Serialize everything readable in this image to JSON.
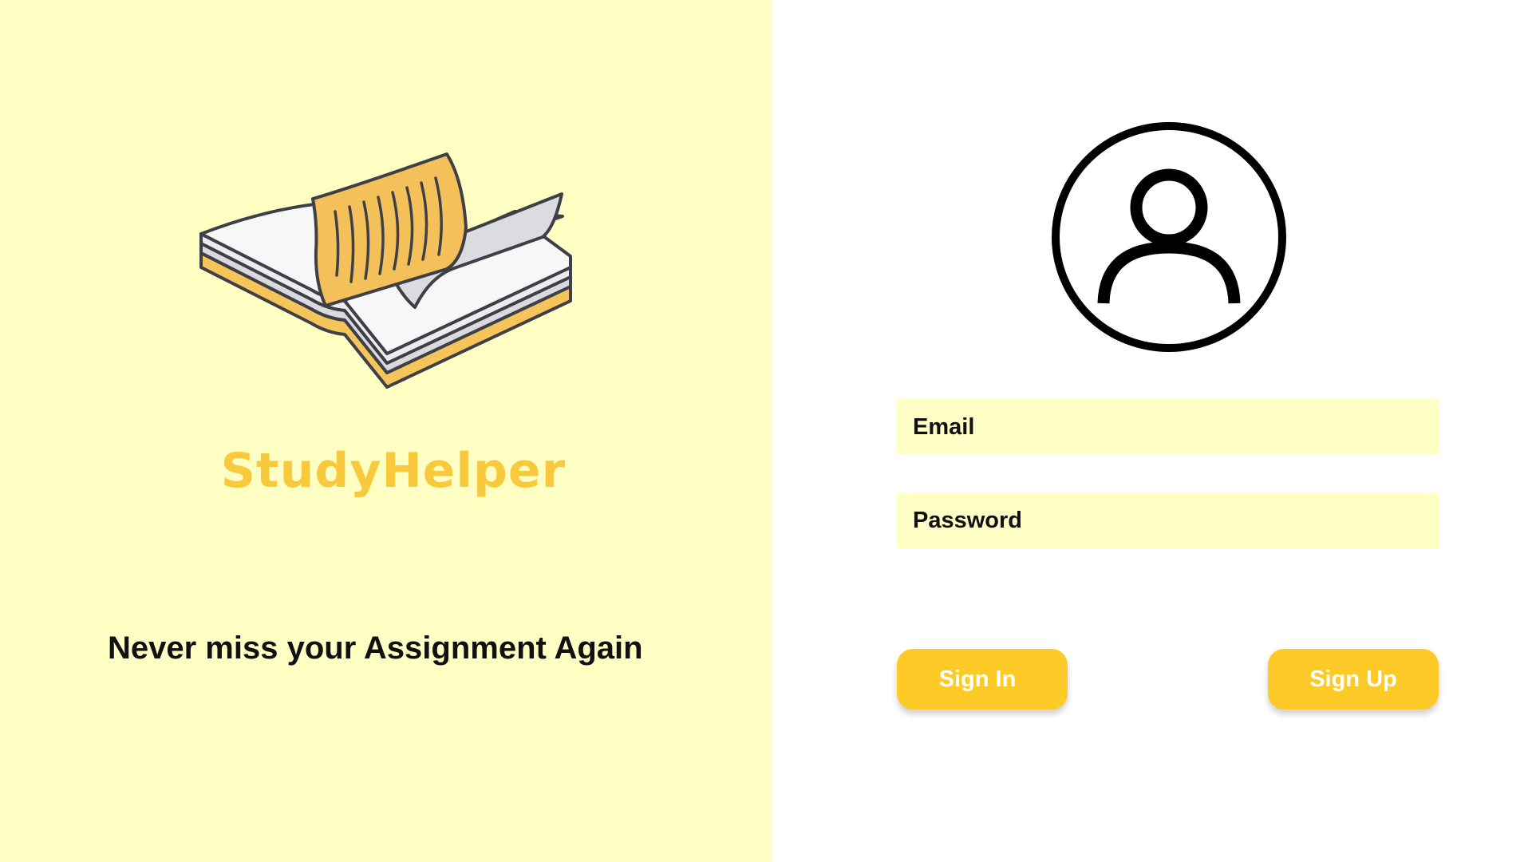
{
  "brand": {
    "name": "StudyHelper",
    "logo_icon": "open-book-icon",
    "tagline": "Never miss your Assignment Again"
  },
  "colors": {
    "left_panel_bg": "#ffffc4",
    "brand_yellow": "#f8c93c",
    "button_yellow": "#fdca28",
    "field_bg": "#ffffc6"
  },
  "login": {
    "avatar_icon": "user-circle-icon",
    "email_label": "Email",
    "password_label": "Password",
    "sign_in_label": "Sign In",
    "sign_up_label": "Sign Up"
  }
}
